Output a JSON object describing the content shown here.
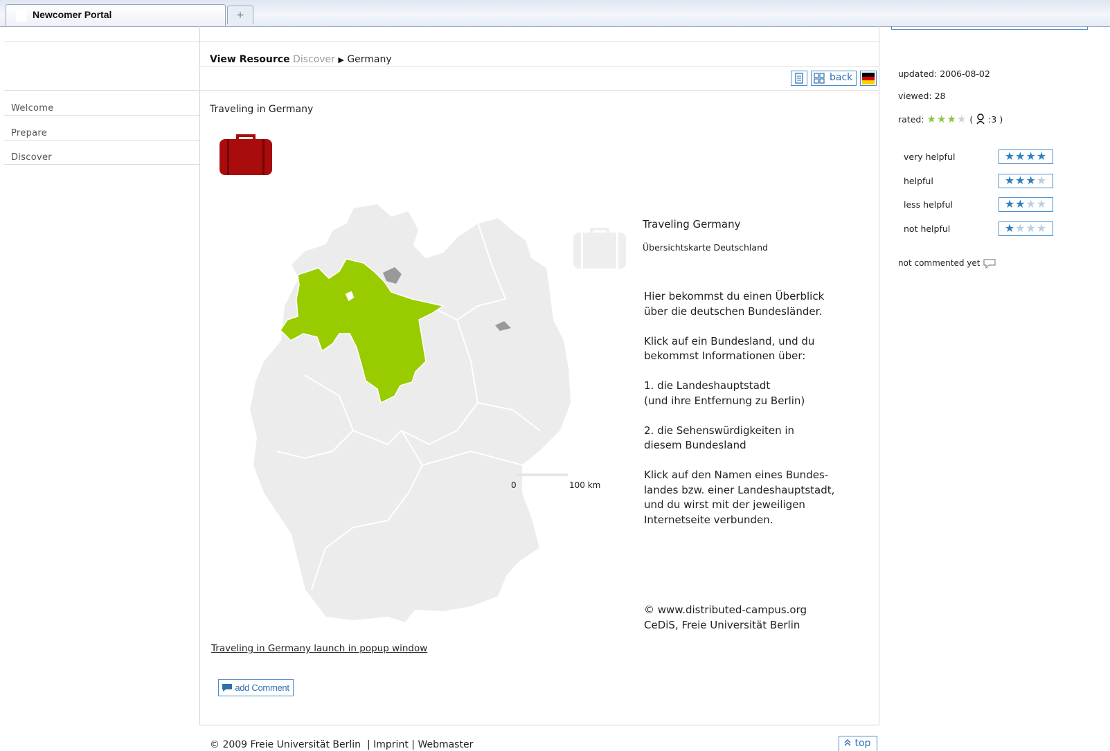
{
  "browser": {
    "tab_title": "Newcomer Portal",
    "new_tab_glyph": "+"
  },
  "nav": {
    "items": [
      {
        "label": "Welcome"
      },
      {
        "label": "Prepare"
      },
      {
        "label": "Discover"
      }
    ]
  },
  "header": {
    "view_label": "View Resource",
    "breadcrumb": [
      "Discover",
      "Germany"
    ],
    "breadcrumb_separator": "▶"
  },
  "toolbar": {
    "back_label": "back",
    "print_icon": "print-icon",
    "sitemap_icon": "sitemap-icon",
    "flag_icon": "german-flag-icon"
  },
  "resource": {
    "title": "Traveling in Germany",
    "icon": "suitcase-icon",
    "map_title": "Traveling Germany",
    "map_subtitle": "Übersichtskarte Deutschland",
    "paragraphs": [
      "Hier bekommst du einen Überblick\nüber die deutschen Bundesländer.",
      "Klick auf ein Bundesland, und du\nbekommst Informationen über:",
      "1. die Landeshauptstadt\n(und ihre Entfernung zu Berlin)",
      "2. die Sehenswürdigkeiten in\ndiesem Bundesland",
      "Klick auf den Namen eines Bundes-\nlandes bzw. einer Landeshauptstadt,\nund du wirst mit der jeweiligen\nInternetseite verbunden."
    ],
    "credit": "© www.distributed-campus.org\nCeDiS, Freie Universität Berlin",
    "scale_start": "0",
    "scale_end": "100 km",
    "popup_link": "Traveling in Germany launch in popup window",
    "highlighted_state_color": "#99cc00",
    "city_state_color": "#999999",
    "map_base_color": "#ececec"
  },
  "comment": {
    "button_label": "add Comment",
    "icon": "comment-bubble-icon"
  },
  "footer": {
    "copyright": "© 2009  Freie Universität Berlin",
    "imprint": "Imprint",
    "webmaster": "Webmaster",
    "separator": "|",
    "top_label": "top"
  },
  "sidebar": {
    "updated_label": "updated:",
    "updated_value": "2006-08-02",
    "viewed_label": "viewed:",
    "viewed_value": "28",
    "rated_label": "rated:",
    "rated_stars": 3,
    "rated_max": 4,
    "rated_count": "3",
    "ratings": [
      {
        "label": "very helpful",
        "stars": 4
      },
      {
        "label": "helpful",
        "stars": 3
      },
      {
        "label": "less helpful",
        "stars": 2
      },
      {
        "label": "not helpful",
        "stars": 1
      }
    ],
    "comment_status": "not commented yet"
  },
  "colors": {
    "accent": "#2f7fbf",
    "suitcase": "#a80c0c"
  }
}
